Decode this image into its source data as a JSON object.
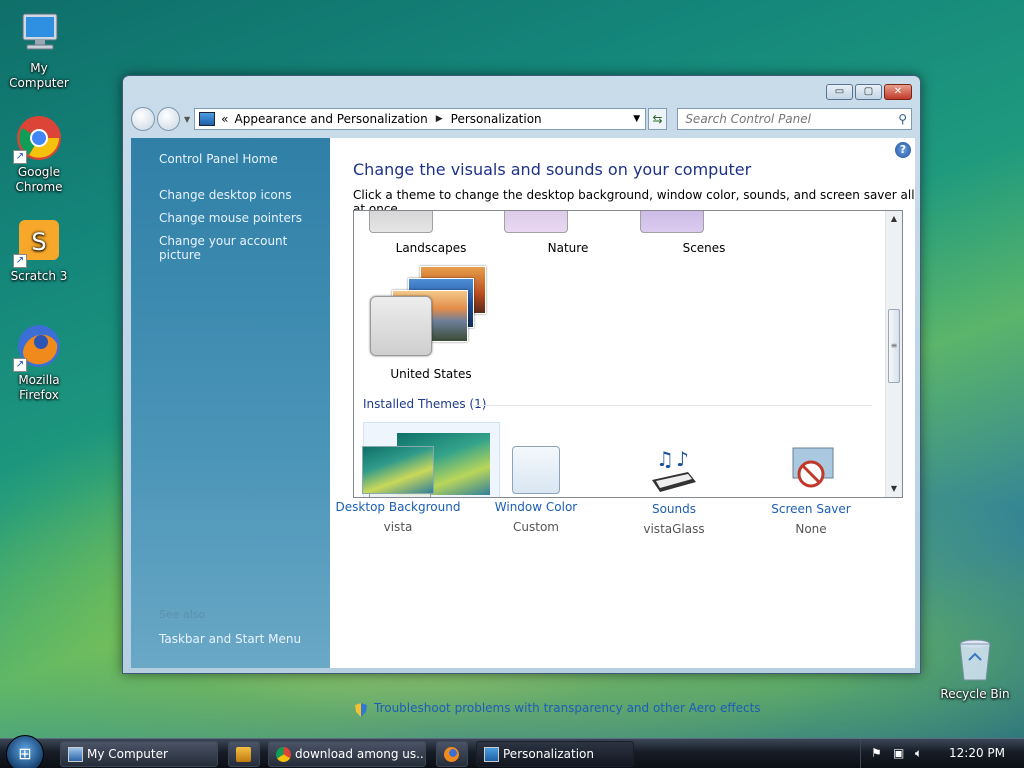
{
  "desktop": {
    "icons": [
      {
        "label": "My Computer"
      },
      {
        "label": "Google Chrome"
      },
      {
        "label": "Scratch 3"
      },
      {
        "label": "Mozilla Firefox"
      },
      {
        "label": "Recycle Bin"
      }
    ]
  },
  "window": {
    "caption": {
      "min": "▭",
      "max": "▢",
      "close": "✕"
    },
    "address": {
      "prefix": "«",
      "segment1": "Appearance and Personalization",
      "segment2": "Personalization"
    },
    "search_placeholder": "Search Control Panel",
    "sidebar": {
      "home": "Control Panel Home",
      "links": [
        "Change desktop icons",
        "Change mouse pointers",
        "Change your account picture"
      ],
      "see_also": "See also",
      "taskbar_link": "Taskbar and Start Menu"
    },
    "content": {
      "title": "Change the visuals and sounds on your computer",
      "description": "Click a theme to change the desktop background, window color, sounds, and screen saver all at once.",
      "themes_row1": [
        "Landscapes",
        "Nature",
        "Scenes"
      ],
      "theme_us": "United States",
      "installed_header": "Installed Themes (1)",
      "bottom": [
        {
          "label": "Desktop Background",
          "value": "vista"
        },
        {
          "label": "Window Color",
          "value": "Custom"
        },
        {
          "label": "Sounds",
          "value": "vistaGlass"
        },
        {
          "label": "Screen Saver",
          "value": "None"
        }
      ],
      "troubleshoot": "Troubleshoot problems with transparency and other Aero effects"
    }
  },
  "taskbar": {
    "buttons": [
      {
        "label": "My Computer"
      },
      {
        "label": "download among us..."
      },
      {
        "label": "Personalization"
      }
    ],
    "clock": "12:20 PM"
  }
}
